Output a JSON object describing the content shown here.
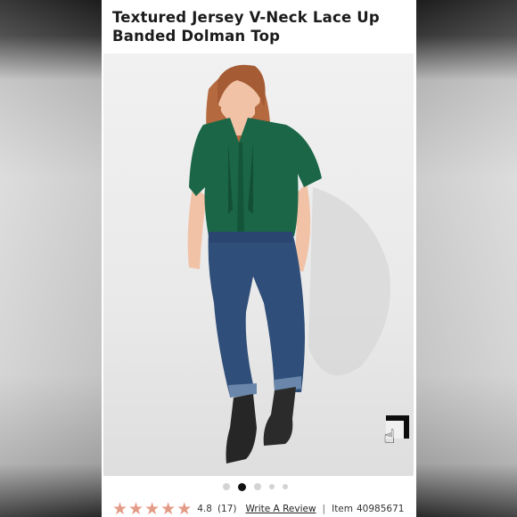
{
  "product": {
    "title": "Textured Jersey V-Neck Lace Up Banded Dolman Top"
  },
  "gallery": {
    "image_count": 5,
    "active_index": 1
  },
  "reviews": {
    "rating": "4.8",
    "count": "(17)",
    "stars": 5,
    "star_color": "#e39b86",
    "write_review_label": "Write A Review"
  },
  "item": {
    "separator": "|",
    "label": "Item",
    "number": "40985671"
  },
  "icons": {
    "zoom": "zoom-hand-icon"
  }
}
